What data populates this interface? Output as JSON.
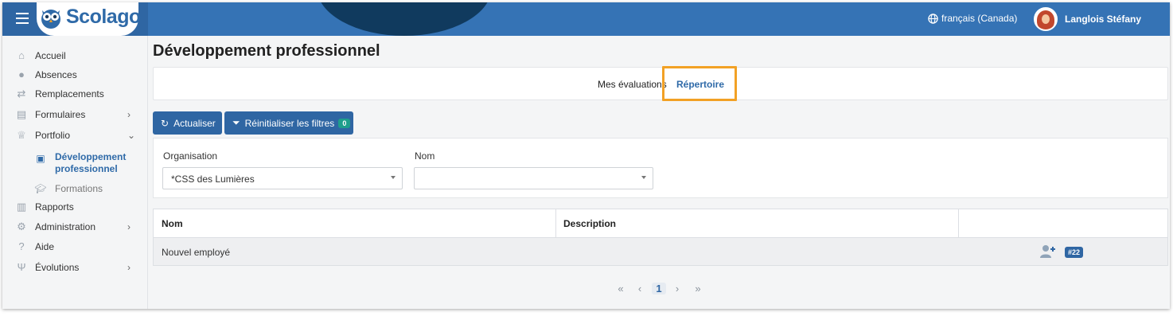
{
  "app": {
    "brand": "Scolago"
  },
  "header": {
    "language": "français (Canada)",
    "user_name": "Langlois Stéfany"
  },
  "sidebar": {
    "items": [
      {
        "label": "Accueil",
        "icon": "home-icon"
      },
      {
        "label": "Absences",
        "icon": "user-clock-icon"
      },
      {
        "label": "Remplacements",
        "icon": "swap-icon"
      },
      {
        "label": "Formulaires",
        "icon": "form-icon"
      },
      {
        "label": "Portfolio",
        "icon": "trophy-icon"
      },
      {
        "label": "Rapports",
        "icon": "report-icon"
      },
      {
        "label": "Administration",
        "icon": "gear-icon"
      },
      {
        "label": "Aide",
        "icon": "question-icon"
      },
      {
        "label": "Évolutions",
        "icon": "sprout-icon"
      }
    ],
    "portfolio_sub": [
      {
        "label": "Développement professionnel",
        "active": true
      },
      {
        "label": "Formations",
        "active": false
      }
    ]
  },
  "main": {
    "title": "Développement professionnel",
    "tabs": [
      {
        "label": "Mes évaluations"
      },
      {
        "label": "Répertoire",
        "active": true
      }
    ],
    "buttons": {
      "refresh": "Actualiser",
      "reset_filters": "Réinitialiser les filtres",
      "filter_count": "0"
    },
    "filters": {
      "organisation_label": "Organisation",
      "organisation_value": "*CSS des Lumières",
      "nom_label": "Nom",
      "nom_value": ""
    },
    "table": {
      "columns": [
        "Nom",
        "Description",
        ""
      ],
      "rows": [
        {
          "nom": "Nouvel employé",
          "description": "",
          "tag": "#22"
        }
      ]
    },
    "pagination": {
      "first": "«",
      "prev": "‹",
      "current": "1",
      "next": "›",
      "last": "»"
    }
  },
  "colors": {
    "topbar": "#3573b5",
    "accent": "#2f66a3",
    "highlight": "#f2a125",
    "count_badge": "#1e9e8c"
  }
}
